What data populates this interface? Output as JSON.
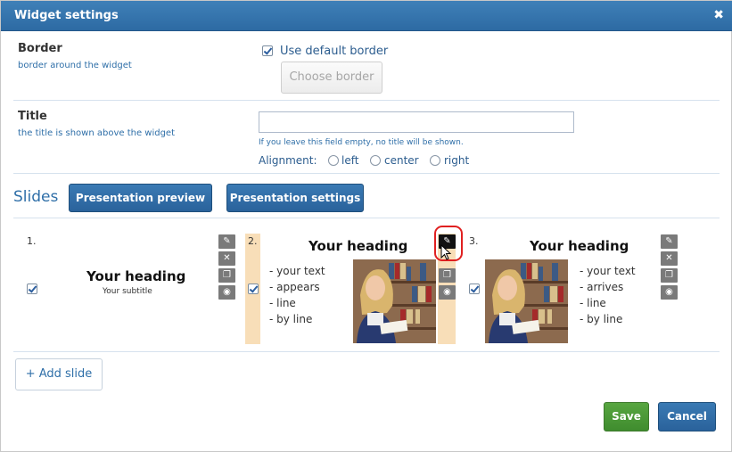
{
  "dialog": {
    "title": "Widget settings",
    "close_glyph": "✖"
  },
  "border": {
    "title": "Border",
    "subtitle": "border around the widget",
    "use_default_label": "Use default border",
    "use_default_checked": true,
    "choose_button": "Choose border"
  },
  "title_section": {
    "title": "Title",
    "subtitle": "the title is shown above the widget",
    "input_value": "",
    "hint": "If you leave this field empty, no title will be shown.",
    "alignment_label": "Alignment:",
    "alignment_options": [
      "left",
      "center",
      "right"
    ]
  },
  "slides": {
    "label": "Slides",
    "preview_button": "Presentation preview",
    "settings_button": "Presentation settings",
    "items": [
      {
        "number": "1.",
        "heading": "Your heading",
        "subtitle": "Your subtitle",
        "checked": true
      },
      {
        "number": "2.",
        "heading": "Your heading",
        "lines": [
          "- your text",
          "- appears",
          "- line",
          "- by line"
        ],
        "checked": true,
        "selected": true
      },
      {
        "number": "3.",
        "heading": "Your heading",
        "lines": [
          "- your text",
          "- arrives",
          "- line",
          "- by line"
        ],
        "checked": true
      }
    ],
    "tool_icons": [
      "pencil-icon",
      "close-icon",
      "copy-icon",
      "eye-icon"
    ],
    "add_slide": "+ Add slide"
  },
  "footer": {
    "save": "Save",
    "cancel": "Cancel"
  },
  "colors": {
    "accent": "#2d6aa3",
    "save_green": "#4a9a36",
    "highlight": "#e02020",
    "selected_slide": "#f8deb8"
  }
}
